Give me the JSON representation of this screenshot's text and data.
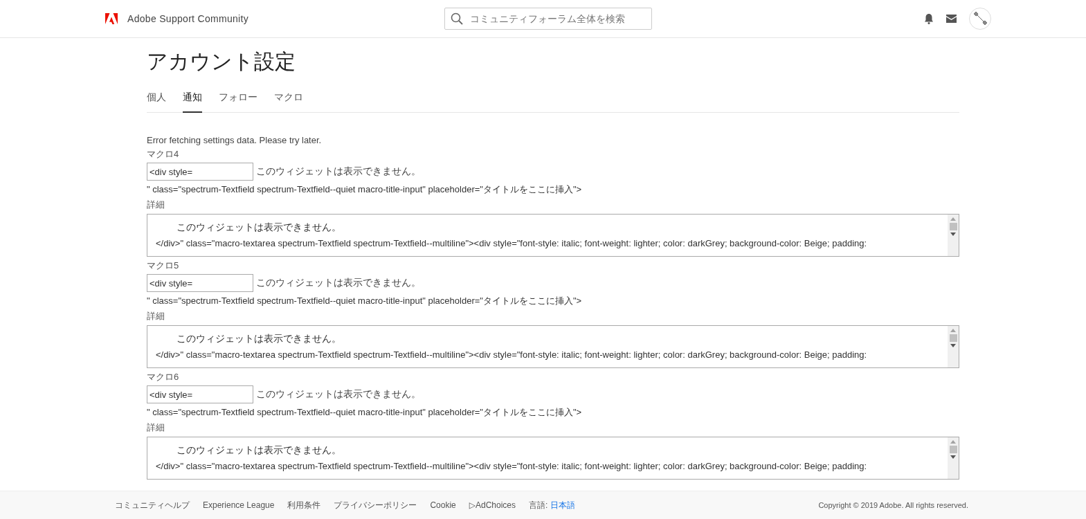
{
  "header": {
    "brand": "Adobe Support Community",
    "search": {
      "placeholder": "コミュニティフォーラム全体を検索"
    }
  },
  "page": {
    "title": "アカウント設定",
    "tabs": [
      {
        "label": "個人",
        "selected": false
      },
      {
        "label": "通知",
        "selected": true
      },
      {
        "label": "フォロー",
        "selected": false
      },
      {
        "label": "マクロ",
        "selected": false
      }
    ],
    "error": "Error fetching settings data. Please try later.",
    "macros": [
      {
        "name": "マクロ4",
        "title_value": "<div style=",
        "widget_note": "このウィジェットは表示できません。",
        "title_tail": "\" class=\"spectrum-Textfield spectrum-Textfield--quiet macro-title-input\" placeholder=\"タイトルをここに挿入\">",
        "details_label": "詳細",
        "details_lines": [
          "このウィジェットは表示できません。",
          "</div>\" class=\"macro-textarea spectrum-Textfield spectrum-Textfield--multiline\"><div style=\"font-style: italic; font-weight: lighter; color: darkGrey; background-color: Beige; padding:"
        ]
      },
      {
        "name": "マクロ5",
        "title_value": "<div style=",
        "widget_note": "このウィジェットは表示できません。",
        "title_tail": "\" class=\"spectrum-Textfield spectrum-Textfield--quiet macro-title-input\" placeholder=\"タイトルをここに挿入\">",
        "details_label": "詳細",
        "details_lines": [
          "このウィジェットは表示できません。",
          "</div>\" class=\"macro-textarea spectrum-Textfield spectrum-Textfield--multiline\"><div style=\"font-style: italic; font-weight: lighter; color: darkGrey; background-color: Beige; padding:"
        ]
      },
      {
        "name": "マクロ6",
        "title_value": "<div style=",
        "widget_note": "このウィジェットは表示できません。",
        "title_tail": "\" class=\"spectrum-Textfield spectrum-Textfield--quiet macro-title-input\" placeholder=\"タイトルをここに挿入\">",
        "details_label": "詳細",
        "details_lines": [
          "このウィジェットは表示できません。",
          "</div>\" class=\"macro-textarea spectrum-Textfield spectrum-Textfield--multiline\"><div style=\"font-style: italic; font-weight: lighter; color: darkGrey; background-color: Beige; padding:"
        ]
      }
    ]
  },
  "footer": {
    "links": [
      "コミュニティヘルプ",
      "Experience League",
      "利用条件",
      "プライバシーポリシー",
      "Cookie",
      "▷AdChoices"
    ],
    "language_label": "言語:",
    "language": "日本語",
    "copyright": "Copyright © 2019 Adobe. All rights reserved."
  }
}
